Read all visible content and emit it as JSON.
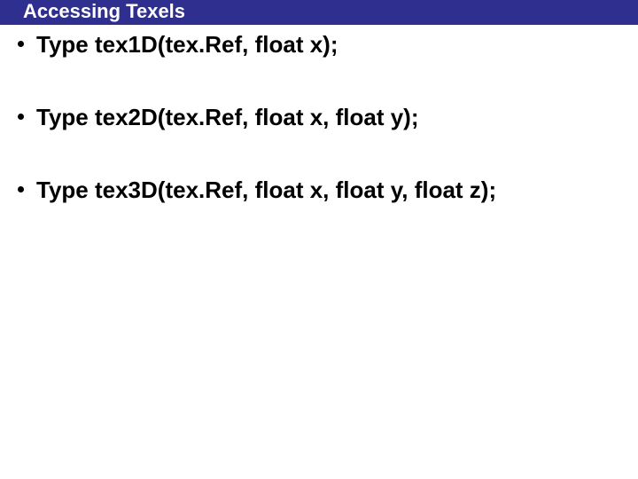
{
  "title": "Accessing Texels",
  "bullets": [
    "Type tex1D(tex.Ref, float x);",
    "Type tex2D(tex.Ref, float x, float y);",
    "Type tex3D(tex.Ref, float x, float y, float z);"
  ]
}
